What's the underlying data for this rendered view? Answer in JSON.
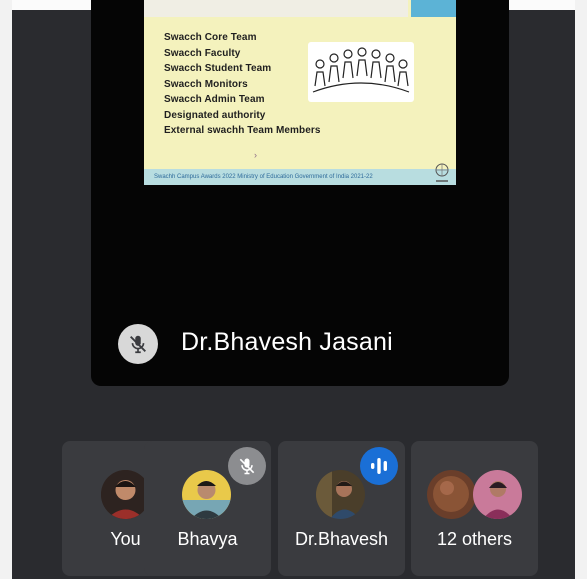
{
  "slide": {
    "items": [
      "Swacch Core Team",
      "Swacch Faculty",
      "Swacch Student Team",
      "Swacch Monitors",
      "Swacch Admin Team",
      "Designated authority",
      "External swachh Team Members"
    ],
    "arrow": "›",
    "footer": "Swachh Campus Awards 2022 Ministry of Education Government of India 2021-22"
  },
  "speaker": {
    "name": "Dr.Bhavesh Jasani",
    "mic_icon": "mic-off-icon"
  },
  "participants": [
    {
      "label": "You"
    },
    {
      "label": "Bhavya",
      "badge": "mic-off-icon"
    },
    {
      "label": "Dr.Bhavesh",
      "badge": "audio-wave-icon"
    },
    {
      "label": "12 others"
    }
  ],
  "colors": {
    "background": "#2a2b2f",
    "tile": "#3a3b3f",
    "speaking_badge": "#1a6fd6",
    "muted_badge": "#8c8d90"
  }
}
